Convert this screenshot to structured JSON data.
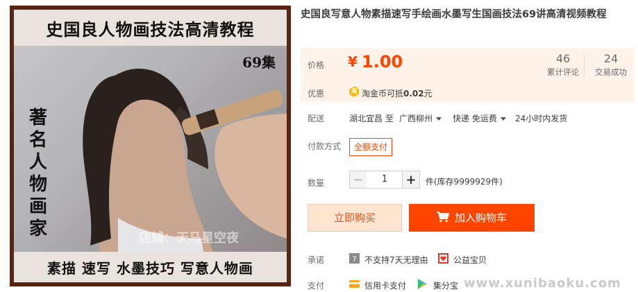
{
  "image": {
    "top_text": "史国良人物画技法高清教程",
    "episodes": "69集",
    "vertical_text": "著名人物画家",
    "bottom_text": "素描 速写 水墨技巧 写意人物画",
    "watermark": "店铺：天马星空夜"
  },
  "title": "史国良写意人物素描速写手绘画水墨写生国画技法69讲高清视频教程",
  "price": {
    "label": "价格",
    "currency": "¥",
    "value": "1.00",
    "reviews_count": "46",
    "reviews_label": "累计评论",
    "deals_count": "24",
    "deals_label": "交易成功"
  },
  "promo": {
    "label": "优惠",
    "icon": "淘",
    "text_prefix": "淘金币可抵",
    "amount": "0.02",
    "text_suffix": "元"
  },
  "delivery": {
    "label": "配送",
    "from": "湖北宜昌 至",
    "to": "广西柳州",
    "method": "快递 免运费",
    "ship_time": "24小时内发货"
  },
  "payment_type": {
    "label": "付款方式",
    "option": "全额支付"
  },
  "quantity": {
    "label": "数量",
    "minus": "−",
    "value": "1",
    "plus": "+",
    "stock": "件(库存9999929件)"
  },
  "buttons": {
    "buy_now": "立即购买",
    "add_cart": "加入购物车"
  },
  "promise": {
    "label": "承诺",
    "no_return": "不支持7天无理由",
    "charity": "公益宝贝"
  },
  "pay": {
    "label": "支付",
    "credit_card": "信用卡支付",
    "jifenbao": "集分宝"
  },
  "site_watermark": "www.xunibaoku.com",
  "colors": {
    "accent": "#ff4400",
    "price_bg": "#fff2e8"
  }
}
